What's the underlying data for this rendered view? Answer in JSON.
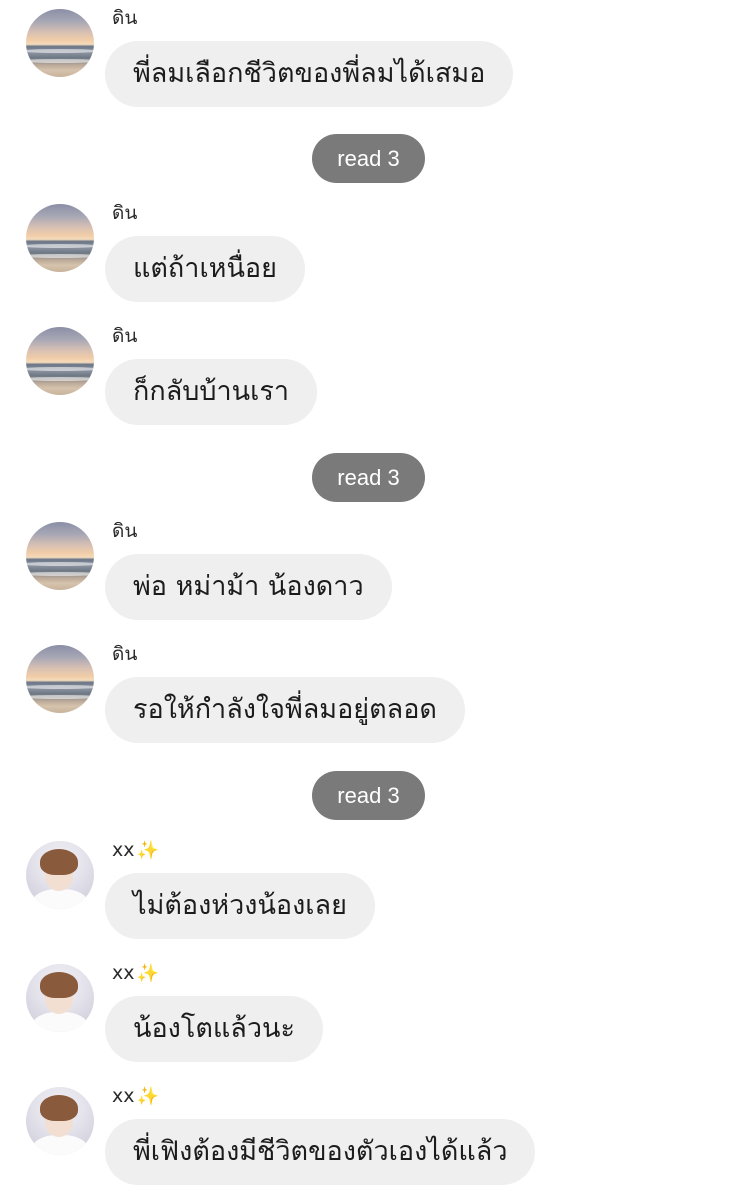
{
  "messages": [
    {
      "sender": "ดิน",
      "text": "พี่ลมเลือกชีวิตของพี่ลมได้เสมอ"
    },
    {
      "sender": "ดิน",
      "text": "แต่ถ้าเหนื่อย"
    },
    {
      "sender": "ดิน",
      "text": "ก็กลับบ้านเรา"
    },
    {
      "sender": "ดิน",
      "text": "พ่อ หม่าม้า น้องดาว"
    },
    {
      "sender": "ดิน",
      "text": "รอให้กำลังใจพี่ลมอยู่ตลอด"
    },
    {
      "sender": "xx",
      "sender_emoji": "✨",
      "text": "ไม่ต้องห่วงน้องเลย"
    },
    {
      "sender": "xx",
      "sender_emoji": "✨",
      "text": "น้องโตแล้วนะ"
    },
    {
      "sender": "xx",
      "sender_emoji": "✨",
      "text": "พี่เฟิงต้องมีชีวิตของตัวเองได้แล้ว"
    }
  ],
  "read_receipts": [
    {
      "label": "read 3"
    },
    {
      "label": "read 3"
    },
    {
      "label": "read 3"
    }
  ],
  "avatars": {
    "din": "sunset-beach-photo",
    "xx": "person-portrait-photo"
  },
  "colors": {
    "bubble_bg": "#efefef",
    "read_badge_bg": "#7a7a7a",
    "sparkle": "#f2c230"
  }
}
